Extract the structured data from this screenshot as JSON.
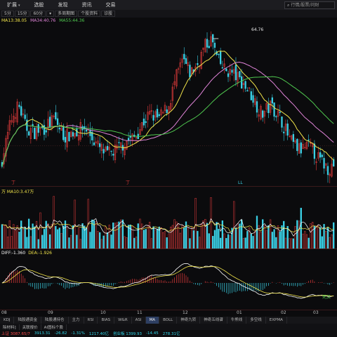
{
  "menu": {
    "items": [
      {
        "label": "扩展",
        "has_caret": true
      },
      {
        "label": "选股"
      },
      {
        "label": "发现"
      },
      {
        "label": "资讯"
      },
      {
        "label": "交易"
      }
    ]
  },
  "search": {
    "placeholder": "行情/股票/问财"
  },
  "toolbar": {
    "items": [
      "5分",
      "15分",
      "60分",
      "多周期图",
      "个股资料",
      "诊股"
    ],
    "dropdown_label": "▾"
  },
  "ma_legend": [
    {
      "label": "MA13:38.05",
      "color": "#f0e34a"
    },
    {
      "label": "MA34:40.76",
      "color": "#e084d8"
    },
    {
      "label": "MA55:44.36",
      "color": "#4fc84f"
    }
  ],
  "price_pane": {
    "high_label": "64.76",
    "signal_labels": [
      "丁",
      "丁",
      "LL"
    ]
  },
  "volume_pane": {
    "legend": "万  MA10:3.47万"
  },
  "macd_pane": {
    "diff_label": "DIFF:-1.360",
    "dea_label": "DEA:-1.926",
    "corner_label": "死叉"
  },
  "time_axis": {
    "labels": [
      "08",
      "09",
      "10",
      "11",
      "12",
      "01",
      "02",
      "03"
    ]
  },
  "indicator_tabs": [
    {
      "label": "KDJ"
    },
    {
      "label": "陆股通资金"
    },
    {
      "label": "陆股通持仓"
    },
    {
      "label": "主力"
    },
    {
      "label": "RSI"
    },
    {
      "label": "BIAS"
    },
    {
      "label": "W&R"
    },
    {
      "label": "ASI"
    },
    {
      "label": "MA",
      "active": true
    },
    {
      "label": "BOLL"
    },
    {
      "label": "神奇九转"
    },
    {
      "label": "神奇五线谱"
    },
    {
      "label": "牛熊线"
    },
    {
      "label": "多空线"
    },
    {
      "label": "EXPMA"
    }
  ],
  "bottom_tabs": [
    "除材料]",
    "关联报价",
    "AI图标个股"
  ],
  "ticker": [
    {
      "text": "上证 3087.65/7",
      "color": "#ff4a4a"
    },
    {
      "text": "3913.31",
      "color": "#2fd5e8"
    },
    {
      "text": "-26.82",
      "color": "#2fd5e8"
    },
    {
      "text": "-1.31%",
      "color": "#2fd5e8"
    },
    {
      "text": "1217.40亿",
      "color": "#2fd5e8"
    },
    {
      "text": "创业板 1399.93",
      "color": "#2fd5e8"
    },
    {
      "text": "-14.45",
      "color": "#2fd5e8"
    },
    {
      "text": "278.31亿",
      "color": "#2fd5e8"
    }
  ],
  "colors": {
    "up": "#e23b3b",
    "down": "#3ad1e6",
    "ma13": "#f0e34a",
    "ma34": "#e084d8",
    "ma55": "#4fc84f",
    "diff": "#ffffff",
    "dea": "#f0e34a"
  },
  "chart_data": {
    "type": "candlestick",
    "periods": 174,
    "candles_ohlc": [],
    "note_high": 64.76
  }
}
